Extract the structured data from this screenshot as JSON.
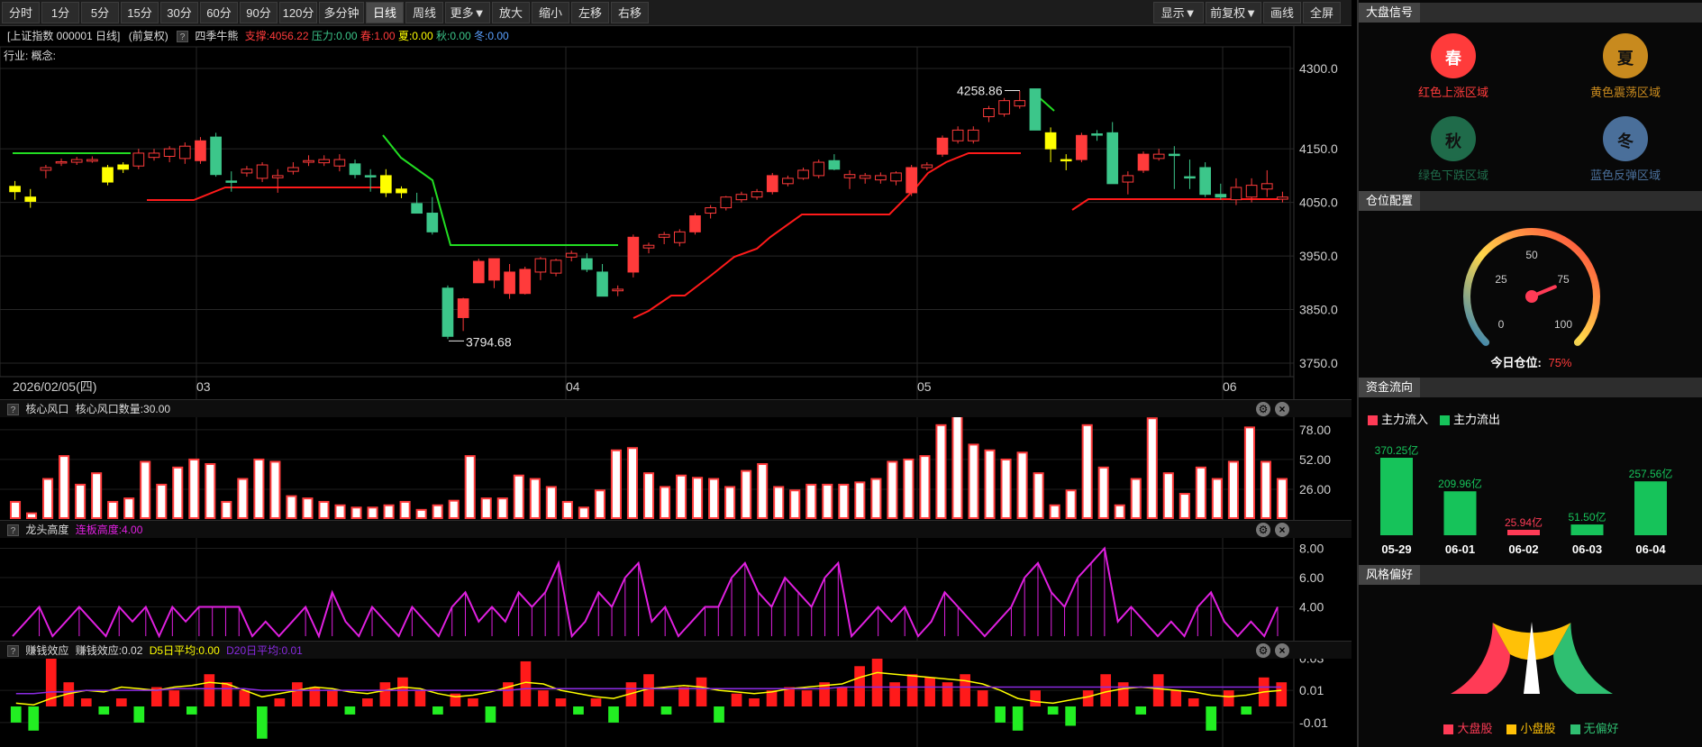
{
  "toolbar": {
    "buttons": [
      "分时",
      "1分",
      "5分",
      "15分",
      "30分",
      "60分",
      "90分",
      "120分",
      "多分钟",
      "日线",
      "周线",
      "更多▼",
      "放大",
      "缩小",
      "左移",
      "右移"
    ],
    "active": "日线",
    "right_buttons": [
      "显示▼",
      "前复权▼",
      "画线",
      "全屏"
    ]
  },
  "infobar": {
    "title": "[上证指数 000001 日线]",
    "adjust": "(前复权)",
    "question": "?",
    "indicator": "四季牛熊",
    "support": "支撑:4056.22",
    "pressure": "压力:0.00",
    "spring": "春:1.00",
    "summer": "夏:0.00",
    "autumn": "秋:0.00",
    "winter": "冬:0.00"
  },
  "industry": "行业: 概念:",
  "main_chart": {
    "price_ticks": [
      "4300.0",
      "4150.0",
      "4050.0",
      "3950.0",
      "3850.0",
      "3750.0"
    ],
    "high_label": "4258.86",
    "low_label": "3794.68",
    "date_label": "2026/02/05(四)",
    "month_labels": [
      "03",
      "04",
      "05",
      "06"
    ]
  },
  "panel1": {
    "q": "?",
    "name": "核心风口",
    "value": "核心风口数量:30.00",
    "ticks": [
      "78.00",
      "52.00",
      "26.00"
    ]
  },
  "panel2": {
    "q": "?",
    "name": "龙头高度",
    "value": "连板高度:4.00",
    "ticks": [
      "8.00",
      "6.00",
      "4.00"
    ]
  },
  "panel3": {
    "q": "?",
    "name": "赚钱效应",
    "value": "赚钱效应:0.02",
    "d5": "D5日平均:0.00",
    "d20": "D20日平均:0.01",
    "ticks": [
      "0.03",
      "0.01",
      "-0.01"
    ]
  },
  "ctl_icons": {
    "gear": "⚙",
    "close": "×"
  },
  "side": {
    "market_signal": {
      "title": "大盘信号",
      "items": [
        {
          "char": "春",
          "label": "红色上涨区域",
          "color": "#ff3b3b"
        },
        {
          "char": "夏",
          "label": "黄色震荡区域",
          "color": "#c88a1e"
        },
        {
          "char": "秋",
          "label": "绿色下跌区域",
          "color": "#1f6b4a"
        },
        {
          "char": "冬",
          "label": "蓝色反弹区域",
          "color": "#4a6f9a"
        }
      ]
    },
    "position": {
      "title": "仓位配置",
      "gauge_ticks": [
        "0",
        "25",
        "50",
        "75",
        "100"
      ],
      "label": "今日仓位:",
      "value": "75%",
      "value_pct": 75
    },
    "fund_flow": {
      "title": "资金流向",
      "legend_in": "主力流入",
      "legend_out": "主力流出",
      "bars": [
        {
          "date": "05-29",
          "value": 370.25,
          "label": "370.25亿",
          "dir": "out"
        },
        {
          "date": "06-01",
          "value": 209.96,
          "label": "209.96亿",
          "dir": "out"
        },
        {
          "date": "06-02",
          "value": 25.94,
          "label": "25.94亿",
          "dir": "in"
        },
        {
          "date": "06-03",
          "value": 51.5,
          "label": "51.50亿",
          "dir": "out"
        },
        {
          "date": "06-04",
          "value": 257.56,
          "label": "257.56亿",
          "dir": "out"
        }
      ]
    },
    "style": {
      "title": "风格偏好",
      "legend": [
        "大盘股",
        "小盘股",
        "无偏好"
      ],
      "colors": [
        "#ff3b56",
        "#ffc107",
        "#2fbf71"
      ]
    }
  },
  "colors": {
    "up": "#ff3b3b",
    "down": "#3cc68a",
    "neutral": "#ffff00"
  },
  "chart_data": [
    {
      "type": "candlestick",
      "title": "上证指数 000001 日线",
      "ylim": [
        3750,
        4300
      ],
      "annotations": [
        {
          "label": "4258.86",
          "value": 4258.86
        },
        {
          "label": "3794.68",
          "value": 3794.68
        }
      ],
      "candles": [
        [
          4080,
          4090,
          4055,
          4070,
          "n"
        ],
        [
          4060,
          4075,
          4040,
          4052,
          "n"
        ],
        [
          4110,
          4120,
          4095,
          4115,
          "u"
        ],
        [
          4125,
          4132,
          4118,
          4126,
          "u"
        ],
        [
          4125,
          4135,
          4120,
          4130,
          "u"
        ],
        [
          4130,
          4136,
          4124,
          4127,
          "u"
        ],
        [
          4088,
          4120,
          4082,
          4115,
          "n"
        ],
        [
          4112,
          4125,
          4105,
          4120,
          "n"
        ],
        [
          4118,
          4150,
          4112,
          4142,
          "u"
        ],
        [
          4142,
          4150,
          4128,
          4134,
          "u"
        ],
        [
          4136,
          4155,
          4125,
          4150,
          "u"
        ],
        [
          4132,
          4162,
          4122,
          4155,
          "u"
        ],
        [
          4128,
          4172,
          4122,
          4165,
          "u"
        ],
        [
          4172,
          4180,
          4098,
          4102,
          "d"
        ],
        [
          4090,
          4108,
          4070,
          4088,
          "d"
        ],
        [
          4105,
          4118,
          4098,
          4112,
          "u"
        ],
        [
          4095,
          4125,
          4088,
          4120,
          "u"
        ],
        [
          4100,
          4112,
          4068,
          4096,
          "u"
        ],
        [
          4108,
          4125,
          4102,
          4115,
          "u"
        ],
        [
          4125,
          4138,
          4118,
          4128,
          "u"
        ],
        [
          4130,
          4138,
          4118,
          4124,
          "u"
        ],
        [
          4118,
          4140,
          4108,
          4130,
          "u"
        ],
        [
          4122,
          4130,
          4095,
          4102,
          "d"
        ],
        [
          4100,
          4112,
          4070,
          4100,
          "d"
        ],
        [
          4100,
          4112,
          4060,
          4068,
          "n"
        ],
        [
          4068,
          4080,
          4058,
          4075,
          "n"
        ],
        [
          4048,
          4068,
          4030,
          4030,
          "d"
        ],
        [
          4030,
          4060,
          3990,
          3995,
          "d"
        ],
        [
          3890,
          3895,
          3795,
          3800,
          "d"
        ],
        [
          3835,
          3872,
          3810,
          3870,
          "u"
        ],
        [
          3900,
          3945,
          3900,
          3940,
          "u"
        ],
        [
          3905,
          3945,
          3890,
          3945,
          "u"
        ],
        [
          3920,
          3935,
          3870,
          3880,
          "u"
        ],
        [
          3880,
          3930,
          3878,
          3925,
          "u"
        ],
        [
          3920,
          3948,
          3905,
          3945,
          "u"
        ],
        [
          3918,
          3945,
          3912,
          3942,
          "u"
        ],
        [
          3948,
          3960,
          3940,
          3955,
          "u"
        ],
        [
          3945,
          3955,
          3920,
          3925,
          "d"
        ],
        [
          3920,
          3935,
          3875,
          3875,
          "d"
        ],
        [
          3888,
          3895,
          3875,
          3885,
          "u"
        ],
        [
          3920,
          3990,
          3910,
          3985,
          "u"
        ],
        [
          3965,
          3975,
          3955,
          3970,
          "u"
        ],
        [
          3985,
          3995,
          3972,
          3990,
          "u"
        ],
        [
          3975,
          4000,
          3968,
          3995,
          "u"
        ],
        [
          3995,
          4030,
          3990,
          4025,
          "u"
        ],
        [
          4030,
          4045,
          4020,
          4040,
          "u"
        ],
        [
          4040,
          4062,
          4035,
          4060,
          "u"
        ],
        [
          4055,
          4070,
          4050,
          4065,
          "u"
        ],
        [
          4060,
          4075,
          4055,
          4070,
          "u"
        ],
        [
          4070,
          4105,
          4065,
          4100,
          "u"
        ],
        [
          4085,
          4100,
          4080,
          4095,
          "u"
        ],
        [
          4095,
          4115,
          4092,
          4110,
          "u"
        ],
        [
          4100,
          4130,
          4095,
          4125,
          "u"
        ],
        [
          4128,
          4140,
          4110,
          4112,
          "d"
        ],
        [
          4102,
          4110,
          4075,
          4096,
          "u"
        ],
        [
          4095,
          4105,
          4085,
          4100,
          "u"
        ],
        [
          4092,
          4106,
          4085,
          4100,
          "u"
        ],
        [
          4090,
          4108,
          4082,
          4105,
          "u"
        ],
        [
          4068,
          4120,
          4062,
          4115,
          "u"
        ],
        [
          4115,
          4125,
          4110,
          4120,
          "u"
        ],
        [
          4140,
          4175,
          4135,
          4170,
          "u"
        ],
        [
          4165,
          4192,
          4160,
          4185,
          "u"
        ],
        [
          4165,
          4192,
          4160,
          4185,
          "u"
        ],
        [
          4210,
          4230,
          4200,
          4225,
          "u"
        ],
        [
          4215,
          4245,
          4210,
          4240,
          "u"
        ],
        [
          4230,
          4258,
          4225,
          4240,
          "u"
        ],
        [
          4262,
          4262,
          4185,
          4185,
          "d"
        ],
        [
          4180,
          4190,
          4125,
          4150,
          "n"
        ],
        [
          4130,
          4140,
          4110,
          4130,
          "n"
        ],
        [
          4130,
          4180,
          4125,
          4175,
          "u"
        ],
        [
          4178,
          4185,
          4165,
          4178,
          "d"
        ],
        [
          4180,
          4200,
          4085,
          4085,
          "d"
        ],
        [
          4088,
          4108,
          4065,
          4100,
          "u"
        ],
        [
          4110,
          4145,
          4105,
          4140,
          "u"
        ],
        [
          4140,
          4150,
          4128,
          4132,
          "u"
        ],
        [
          4140,
          4155,
          4075,
          4140,
          "d"
        ],
        [
          4098,
          4130,
          4075,
          4098,
          "d"
        ],
        [
          4115,
          4125,
          4060,
          4065,
          "d"
        ],
        [
          4065,
          4085,
          4055,
          4060,
          "d"
        ],
        [
          4055,
          4095,
          4045,
          4078,
          "u"
        ],
        [
          4082,
          4095,
          4050,
          4060,
          "u"
        ],
        [
          4085,
          4110,
          4060,
          4075,
          "u"
        ],
        [
          4060,
          4070,
          4050,
          4056,
          "u"
        ]
      ]
    },
    {
      "type": "bar",
      "title": "核心风口",
      "ylim": [
        0,
        85
      ],
      "values": [
        15,
        5,
        35,
        55,
        30,
        40,
        15,
        18,
        50,
        30,
        45,
        52,
        48,
        15,
        35,
        52,
        50,
        20,
        18,
        15,
        12,
        10,
        10,
        12,
        15,
        8,
        12,
        16,
        55,
        18,
        18,
        38,
        35,
        28,
        15,
        10,
        25,
        60,
        62,
        40,
        28,
        38,
        36,
        35,
        28,
        42,
        48,
        28,
        25,
        30,
        30,
        30,
        32,
        35,
        50,
        52,
        55,
        82,
        90,
        65,
        60,
        52,
        58,
        40,
        12,
        25,
        82,
        45,
        12,
        35,
        88,
        40,
        22,
        45,
        35,
        50,
        80,
        50,
        35
      ],
      "ticks": [
        26,
        52,
        78
      ]
    },
    {
      "type": "line",
      "title": "龙头高度",
      "ylim": [
        2,
        8.5
      ],
      "values": [
        2,
        3,
        4,
        2,
        3,
        4,
        3,
        2,
        4,
        3,
        4,
        2,
        4,
        3,
        4,
        4,
        4,
        4,
        2,
        3,
        2,
        3,
        4,
        2,
        5,
        3,
        2,
        4,
        3,
        2,
        4,
        3,
        2,
        4,
        5,
        3,
        4,
        3,
        5,
        4,
        5,
        7,
        2,
        3,
        5,
        4,
        6,
        7,
        3,
        4,
        2,
        3,
        4,
        4,
        6,
        7,
        5,
        4,
        6,
        5,
        4,
        6,
        7,
        2,
        3,
        4,
        3,
        4,
        2,
        3,
        5,
        4,
        3,
        2,
        3,
        4,
        6,
        7,
        5,
        4,
        6,
        7,
        8,
        3,
        4,
        3,
        2,
        3,
        2,
        4,
        5,
        3,
        2,
        3,
        2,
        4
      ],
      "ticks": [
        4,
        6,
        8
      ]
    },
    {
      "type": "bar",
      "title": "赚钱效应",
      "ylim": [
        -0.02,
        0.035
      ],
      "series": [
        {
          "name": "赚钱效应",
          "values": [
            -0.01,
            -0.015,
            0.03,
            0.015,
            0.005,
            -0.005,
            0.005,
            -0.01,
            0.012,
            0.01,
            -0.005,
            0.02,
            0.015,
            0.01,
            -0.02,
            0.005,
            0.015,
            0.012,
            0.01,
            -0.005,
            0.005,
            0.015,
            0.018,
            0.01,
            -0.005,
            0.008,
            0.005,
            -0.01,
            0.015,
            0.028,
            0.01,
            0.005,
            -0.005,
            0.005,
            -0.01,
            0.015,
            0.02,
            -0.005,
            0.012,
            0.018,
            -0.01,
            0.008,
            0.005,
            0.01,
            0.012,
            0.01,
            0.015,
            0.012,
            0.025,
            0.032,
            0.015,
            0.02,
            0.018,
            0.015,
            0.02,
            0.01,
            -0.01,
            -0.015,
            0.01,
            -0.005,
            -0.012,
            0.01,
            0.02,
            0.015,
            -0.005,
            0.02,
            0.01,
            0.005,
            -0.015,
            0.01,
            -0.005,
            0.018,
            0.015
          ]
        }
      ],
      "lines": [
        {
          "name": "D5日平均",
          "values": [
            0.002,
            0.001,
            0.005,
            0.008,
            0.01,
            0.009,
            0.012,
            0.011,
            0.01,
            0.012,
            0.013,
            0.015,
            0.014,
            0.01,
            0.006,
            0.008,
            0.01,
            0.012,
            0.011,
            0.009,
            0.008,
            0.01,
            0.012,
            0.011,
            0.008,
            0.006,
            0.007,
            0.009,
            0.012,
            0.015,
            0.014,
            0.01,
            0.008,
            0.006,
            0.005,
            0.008,
            0.011,
            0.012,
            0.013,
            0.012,
            0.01,
            0.009,
            0.008,
            0.009,
            0.011,
            0.012,
            0.013,
            0.014,
            0.018,
            0.021,
            0.02,
            0.019,
            0.018,
            0.017,
            0.016,
            0.014,
            0.01,
            0.005,
            0.003,
            0.002,
            0.004,
            0.006,
            0.009,
            0.011,
            0.012,
            0.011,
            0.01,
            0.009,
            0.007,
            0.006,
            0.007,
            0.009,
            0.01
          ]
        },
        {
          "name": "D20日平均",
          "values": [
            0.008,
            0.008,
            0.009,
            0.009,
            0.01,
            0.01,
            0.01,
            0.01,
            0.01,
            0.011,
            0.011,
            0.011,
            0.011,
            0.011,
            0.01,
            0.01,
            0.01,
            0.01,
            0.01,
            0.01,
            0.01,
            0.01,
            0.01,
            0.01,
            0.01,
            0.01,
            0.01,
            0.01,
            0.01,
            0.011,
            0.011,
            0.011,
            0.011,
            0.011,
            0.011,
            0.011,
            0.011,
            0.011,
            0.011,
            0.011,
            0.011,
            0.011,
            0.011,
            0.011,
            0.011,
            0.011,
            0.011,
            0.012,
            0.012,
            0.012,
            0.012,
            0.012,
            0.012,
            0.012,
            0.012,
            0.012,
            0.012,
            0.012,
            0.012,
            0.012,
            0.012,
            0.012,
            0.012,
            0.012,
            0.012,
            0.012,
            0.012,
            0.012,
            0.012,
            0.012,
            0.012,
            0.012,
            0.012
          ]
        }
      ],
      "ticks": [
        -0.01,
        0.01,
        0.03
      ]
    }
  ]
}
